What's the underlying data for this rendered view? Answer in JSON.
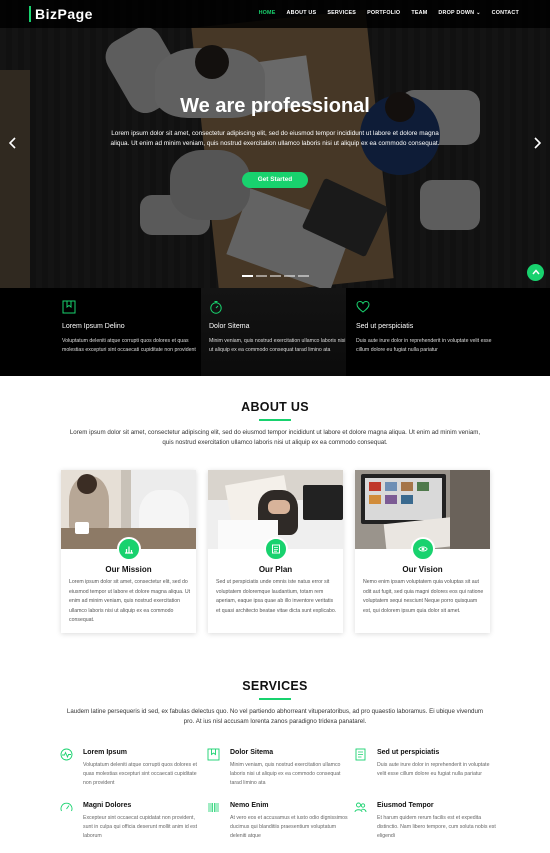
{
  "brand": {
    "name": "BizPage",
    "accent": "#18d26e"
  },
  "nav": {
    "items": [
      {
        "label": "HOME",
        "active": true
      },
      {
        "label": "ABOUT US"
      },
      {
        "label": "SERVICES"
      },
      {
        "label": "PORTFOLIO"
      },
      {
        "label": "TEAM"
      },
      {
        "label": "DROP DOWN"
      },
      {
        "label": "CONTACT"
      }
    ]
  },
  "hero": {
    "title": "We are professional",
    "text": "Lorem ipsum dolor sit amet, consectetur adipiscing elit, sed do eiusmod tempor incididunt ut labore et dolore magna aliqua. Ut enim ad minim veniam, quis nostrud exercitation ullamco laboris nisi ut aliquip ex ea commodo consequat.",
    "button": "Get Started",
    "prev_icon": "chevron-left-icon",
    "next_icon": "chevron-right-icon",
    "slides_count": 5,
    "active_slide": 1
  },
  "features": [
    {
      "icon": "bookmark-icon",
      "title": "Lorem Ipsum Delino",
      "text": "Voluptatum deleniti atque corrupti quos dolores et quas molestias excepturi sint occaecati cupiditate non provident"
    },
    {
      "icon": "stopwatch-icon",
      "title": "Dolor Sitema",
      "text": "Minim veniam, quis nostrud exercitation ullamco laboris nisi ut aliquip ex ea commodo consequat tarad limino ata"
    },
    {
      "icon": "heart-icon",
      "title": "Sed ut perspiciatis",
      "text": "Duis aute irure dolor in reprehenderit in voluptate velit esse cillum dolore eu fugiat nulla pariatur"
    }
  ],
  "about": {
    "title": "ABOUT US",
    "text": "Lorem ipsum dolor sit amet, consectetur adipiscing elit, sed do eiusmod tempor incididunt ut labore et dolore magna aliqua. Ut enim ad minim veniam, quis nostrud exercitation ullamco laboris nisi ut aliquip ex ea commodo consequat.",
    "cards": [
      {
        "icon": "bar-chart-icon",
        "title": "Our Mission",
        "text": "Lorem ipsum dolor sit amet, consectetur elit, sed do eiusmod tempor ut labore et dolore magna aliqua. Ut enim ad minim veniam, quis nostrud exercitation ullamco laboris nisi ut aliquip ex ea commodo consequat."
      },
      {
        "icon": "list-icon",
        "title": "Our Plan",
        "text": "Sed ut perspiciatis unde omnis iste natus error sit voluptatem doloremque laudantium, totam rem aperiam, eaque ipsa quae ab illo inventore veritatis et quasi architecto beatae vitae dicta sunt explicabo."
      },
      {
        "icon": "eye-icon",
        "title": "Our Vision",
        "text": "Nemo enim ipsam voluptatem quia voluptas sit aut odit aut fugit, sed quia magni dolores eos qui ratione voluptatem sequi nesciunt Neque porro quisquam est, qui dolorem ipsum quia dolor sit amet."
      }
    ]
  },
  "services": {
    "title": "SERVICES",
    "text": "Laudem latine persequeris id sed, ex fabulas delectus quo. No vel partiendo abhorreant vituperatoribus, ad pro quaestio laboramus. Ei ubique vivendum pro. At ius nisl accusam lorenta zanos paradigno tridexa panatarel.",
    "items": [
      {
        "icon": "pulse-icon",
        "title": "Lorem Ipsum",
        "text": "Voluptatum deleniti atque corrupti quos dolores et quas molestias excepturi sint occaecati cupiditate non provident"
      },
      {
        "icon": "bookmark-icon",
        "title": "Dolor Sitema",
        "text": "Minim veniam, quis nostrud exercitation ullamco laboris nisi ut aliquip ex ea commodo consequat tarad limino ata"
      },
      {
        "icon": "document-icon",
        "title": "Sed ut perspiciatis",
        "text": "Duis aute irure dolor in reprehenderit in voluptate velit esse cillum dolore eu fugiat nulla pariatur"
      },
      {
        "icon": "speedometer-icon",
        "title": "Magni Dolores",
        "text": "Excepteur sint occaecat cupidatat non provident, sunt in culpa qui officia deserunt mollit anim id est laborum"
      },
      {
        "icon": "barcode-icon",
        "title": "Nemo Enim",
        "text": "At vero eos et accusamus et iusto odio dignissimos ducimus qui blanditiis praesentium voluptatum deleniti atque"
      },
      {
        "icon": "people-icon",
        "title": "Eiusmod Tempor",
        "text": "Et harum quidem rerum facilis est et expedita distinctio. Nam libero tempore, cum soluta nobis est eligendi"
      }
    ]
  }
}
